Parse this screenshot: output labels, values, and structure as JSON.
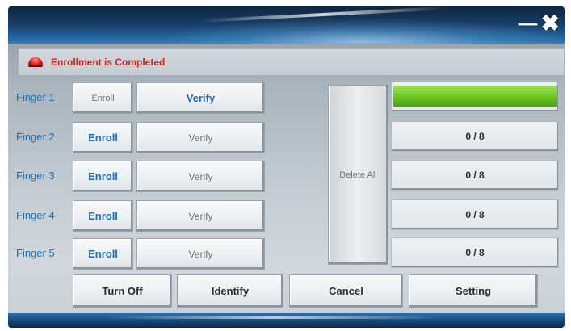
{
  "window": {
    "minimize_glyph": "—",
    "close_glyph": "✖"
  },
  "status": {
    "text": "Enrollment is Completed",
    "light_color": "#e0201a"
  },
  "fingers": [
    {
      "label": "Finger 1",
      "enroll_label": "Enroll",
      "verify_label": "Verify",
      "enroll_active": false,
      "verify_active": true,
      "progress_text": "",
      "progress_fraction": 1.0
    },
    {
      "label": "Finger 2",
      "enroll_label": "Enroll",
      "verify_label": "Verify",
      "enroll_active": true,
      "verify_active": false,
      "progress_text": "0 / 8",
      "progress_fraction": 0
    },
    {
      "label": "Finger 3",
      "enroll_label": "Enroll",
      "verify_label": "Verify",
      "enroll_active": true,
      "verify_active": false,
      "progress_text": "0 / 8",
      "progress_fraction": 0
    },
    {
      "label": "Finger 4",
      "enroll_label": "Enroll",
      "verify_label": "Verify",
      "enroll_active": true,
      "verify_active": false,
      "progress_text": "0 / 8",
      "progress_fraction": 0
    },
    {
      "label": "Finger 5",
      "enroll_label": "Enroll",
      "verify_label": "Verify",
      "enroll_active": true,
      "verify_active": false,
      "progress_text": "0 / 8",
      "progress_fraction": 0
    }
  ],
  "delete_all_label": "Delete All",
  "bottom_buttons": {
    "turn_off": "Turn Off",
    "identify": "Identify",
    "cancel": "Cancel",
    "setting": "Setting"
  },
  "colors": {
    "accent_blue": "#1a6dc0",
    "progress_green": "#6cc522",
    "status_red": "#d8221b"
  }
}
